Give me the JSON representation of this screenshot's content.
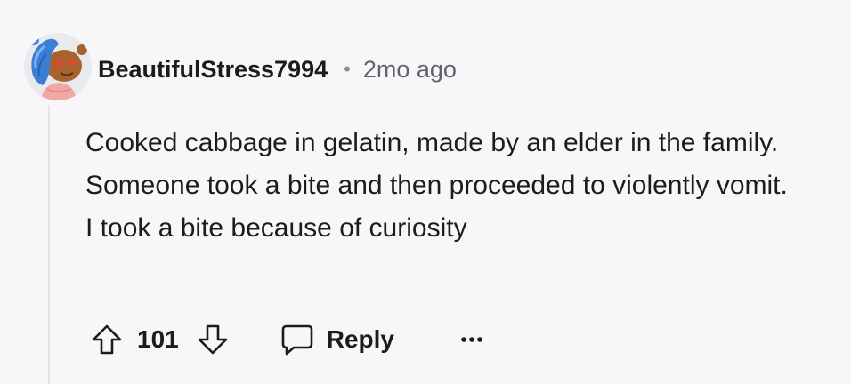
{
  "comment": {
    "author": "BeautifulStress7994",
    "separator": "•",
    "time": "2mo ago",
    "avatar_icon": "reddit-snoo-avatar-icon",
    "body_lines": [
      "Cooked cabbage in gelatin, made by an elder in the family. Someone took a bite and then proceeded to violently vomit.",
      "I took a bite because of curiosity"
    ],
    "votes": "101",
    "upvote_icon": "upvote-arrow-icon",
    "downvote_icon": "downvote-arrow-icon",
    "reply_icon": "speech-bubble-icon",
    "reply_label": "Reply",
    "more_icon": "more-options-icon"
  }
}
